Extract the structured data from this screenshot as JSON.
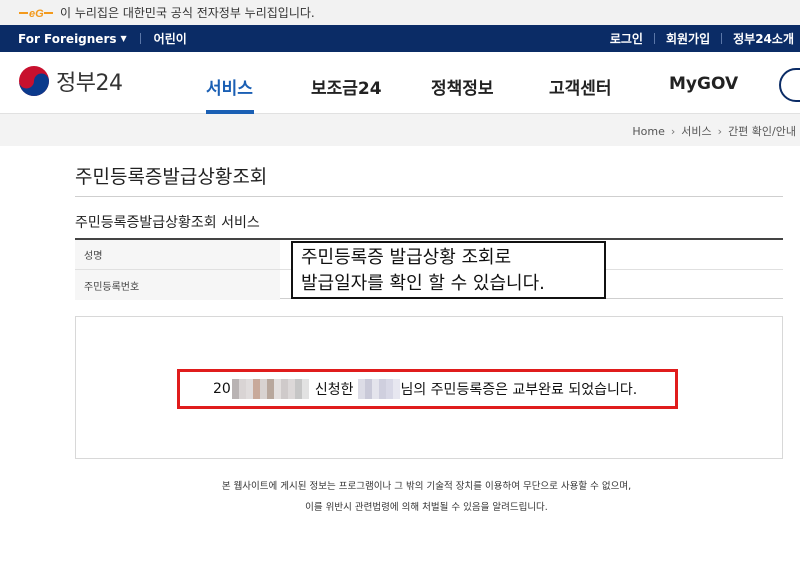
{
  "gov_banner": {
    "text": "이 누리집은 대한민국 공식 전자정부 누리집입니다.",
    "logo_color": "#f39a1d"
  },
  "util_bar": {
    "left": [
      "For Foreigners",
      "어린이"
    ],
    "right": [
      "로그인",
      "회원가입",
      "정부24소개"
    ],
    "bg_color": "#0b2c66"
  },
  "header": {
    "brand": "정부24",
    "nav": [
      "서비스",
      "보조금24",
      "정책정보",
      "고객센터",
      "MyGOV"
    ],
    "active_nav": "서비스",
    "accent_color": "#1a5fb4"
  },
  "breadcrumb": [
    "Home",
    "서비스",
    "간편 확인/안내"
  ],
  "page": {
    "title": "주민등록증발급상황조회",
    "section_title": "주민등록증발급상황조회 서비스",
    "fields": [
      {
        "label": "성명"
      },
      {
        "label": "주민등록번호"
      }
    ]
  },
  "callout": {
    "line1": "주민등록증 발급상황 조회로",
    "line2": "발급일자를 확인 할 수 있습니다."
  },
  "result": {
    "prefix": "20",
    "text1": "신청한",
    "text2": "님의 주민등록증은 교부완료 되었습니다.",
    "highlight_color": "#e01c1c"
  },
  "footer": {
    "line1": "본 웹사이트에 게시된 정보는 프로그램이나 그 밖의 기술적 장치를 이용하여 무단으로 사용할 수 없으며,",
    "line2": "이를 위반시 관련법령에 의해 처벌될 수 있음을 알려드립니다."
  }
}
